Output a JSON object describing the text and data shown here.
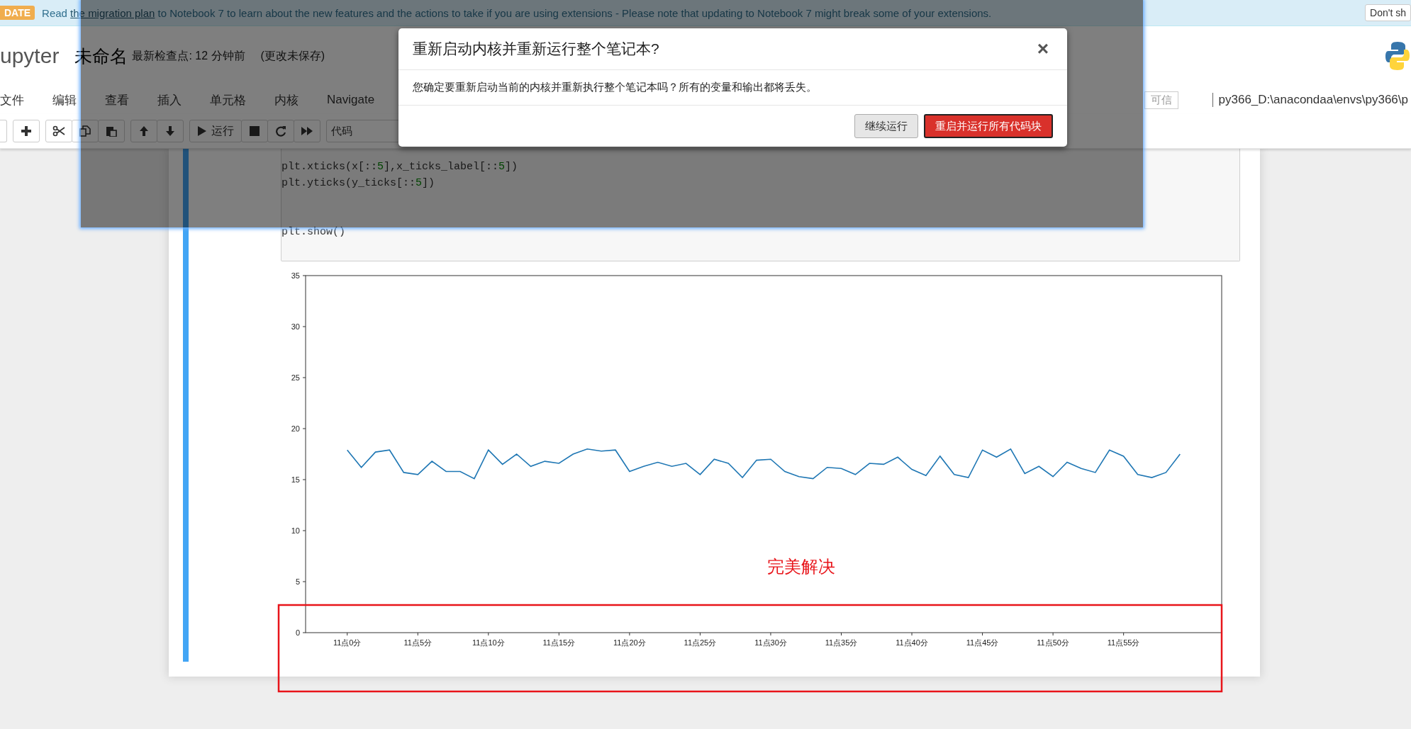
{
  "banner": {
    "badge": "DATE",
    "text_before": "Read ",
    "link": "the migration plan",
    "text_after": " to Notebook 7 to learn about the new features and the actions to take if you are using extensions - Please note that updating to Notebook 7 might break some of your extensions.",
    "dismiss_button": "Don't sh"
  },
  "header": {
    "logo_text": "upyter",
    "notebook_name": "未命名",
    "checkpoint": "最新检查点: 12 分钟前",
    "autosave_status": "(更改未保存)"
  },
  "menu": [
    {
      "label": "文件"
    },
    {
      "label": "编辑"
    },
    {
      "label": "查看"
    },
    {
      "label": "插入"
    },
    {
      "label": "单元格"
    },
    {
      "label": "内核"
    },
    {
      "label": "Navigate"
    }
  ],
  "trusted_badge": "可信",
  "kernel_name": "py366_D:\\anacondaa\\envs\\py366\\p",
  "toolbar": {
    "run_label": "运行",
    "cell_type": "代码"
  },
  "cell": {
    "code_tokens": [
      {
        "t": "plt.xticks(x[::",
        "kind": "plain"
      },
      {
        "t": "5",
        "kind": "number"
      },
      {
        "t": "],x_ticks_label[::",
        "kind": "plain"
      },
      {
        "t": "5",
        "kind": "number"
      },
      {
        "t": "])\nplt.yticks(y_ticks[::",
        "kind": "plain"
      },
      {
        "t": "5",
        "kind": "number"
      },
      {
        "t": "])\n\n\nplt.show()",
        "kind": "plain"
      }
    ],
    "chart_data": {
      "type": "line",
      "categories": [
        "11点0分",
        null,
        null,
        null,
        null,
        "11点5分",
        null,
        null,
        null,
        null,
        "11点10分",
        null,
        null,
        null,
        null,
        "11点15分",
        null,
        null,
        null,
        null,
        "11点20分",
        null,
        null,
        null,
        null,
        "11点25分",
        null,
        null,
        null,
        null,
        "11点30分",
        null,
        null,
        null,
        null,
        "11点35分",
        null,
        null,
        null,
        null,
        "11点40分",
        null,
        null,
        null,
        null,
        "11点45分",
        null,
        null,
        null,
        null,
        "11点50分",
        null,
        null,
        null,
        null,
        "11点55分",
        null,
        null,
        null,
        null
      ],
      "series": [
        {
          "color": "#1f77b4",
          "values": [
            17.9,
            16.2,
            17.7,
            17.9,
            15.7,
            15.5,
            16.8,
            15.8,
            15.8,
            15.1,
            17.9,
            16.5,
            17.5,
            16.3,
            16.8,
            16.6,
            17.5,
            18.0,
            17.8,
            17.9,
            15.8,
            16.3,
            16.7,
            16.3,
            16.6,
            15.5,
            17.0,
            16.6,
            15.2,
            16.9,
            17.0,
            15.8,
            15.3,
            15.1,
            16.2,
            16.1,
            15.5,
            16.6,
            16.5,
            17.2,
            16.0,
            15.4,
            17.3,
            15.5,
            15.2,
            17.9,
            17.2,
            18.0,
            15.6,
            16.3,
            15.3,
            16.7,
            16.1,
            15.7,
            17.9,
            17.3,
            15.5,
            15.2,
            15.7,
            17.5
          ]
        }
      ],
      "ylim": [
        0,
        35
      ],
      "yticks": [
        0,
        5,
        10,
        15,
        20,
        25,
        30,
        35
      ]
    },
    "markup_note": "完美解决"
  },
  "dialog": {
    "title": "重新启动内核并重新运行整个笔记本?",
    "close": "×",
    "message": "您确定要重新启动当前的内核并重新执行整个笔记本吗？所有的变量和输出都将丢失。",
    "buttons": [
      {
        "label": "继续运行",
        "kind": "default"
      },
      {
        "label": "重启并运行所有代码块",
        "kind": "danger"
      }
    ]
  }
}
